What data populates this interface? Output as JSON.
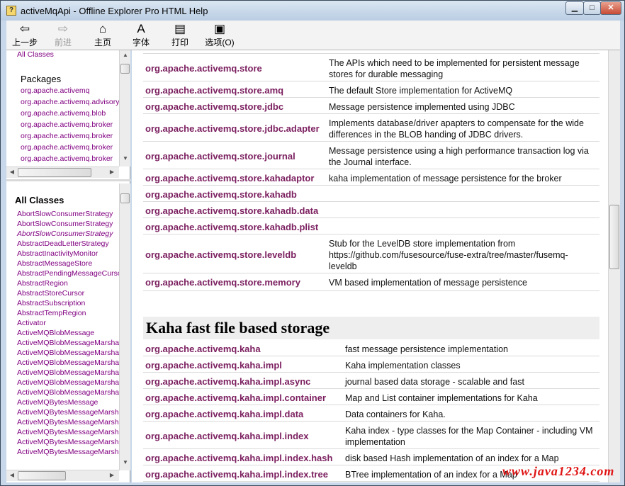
{
  "window": {
    "title": "activeMqApi - Offline Explorer Pro HTML Help",
    "app_icon": "?"
  },
  "toolbar": {
    "back": "上一步",
    "forward": "前进",
    "home": "主页",
    "font": "字体",
    "print": "打印",
    "options": "选项(O)"
  },
  "left_top": {
    "all_classes_link": "All Classes",
    "packages_heading": "Packages",
    "items": [
      "org.apache.activemq",
      "org.apache.activemq.advisory",
      "org.apache.activemq.blob",
      "org.apache.activemq.broker",
      "org.apache.activemq.broker",
      "org.apache.activemq.broker",
      "org.apache.activemq.broker"
    ]
  },
  "left_bottom": {
    "heading": "All Classes",
    "items": [
      "AbortSlowConsumerStrategy",
      "AbortSlowConsumerStrategy",
      "AbortSlowConsumerStrategy",
      "AbstractDeadLetterStrategy",
      "AbstractInactivityMonitor",
      "AbstractMessageStore",
      "AbstractPendingMessageCursor",
      "AbstractRegion",
      "AbstractStoreCursor",
      "AbstractSubscription",
      "AbstractTempRegion",
      "Activator",
      "ActiveMQBlobMessage",
      "ActiveMQBlobMessageMarshaller",
      "ActiveMQBlobMessageMarshaller",
      "ActiveMQBlobMessageMarshaller",
      "ActiveMQBlobMessageMarshaller",
      "ActiveMQBlobMessageMarshaller",
      "ActiveMQBlobMessageMarshaller",
      "ActiveMQBytesMessage",
      "ActiveMQBytesMessageMarshaller",
      "ActiveMQBytesMessageMarshaller",
      "ActiveMQBytesMessageMarshaller",
      "ActiveMQBytesMessageMarshaller",
      "ActiveMQBytesMessageMarshaller"
    ]
  },
  "store_rows": [
    {
      "pkg": "org.apache.activemq.store",
      "desc": "The APIs which need to be implemented for persistent message stores for durable messaging"
    },
    {
      "pkg": "org.apache.activemq.store.amq",
      "desc": "The default Store implementation for ActiveMQ"
    },
    {
      "pkg": "org.apache.activemq.store.jdbc",
      "desc": "Message persistence implemented using JDBC"
    },
    {
      "pkg": "org.apache.activemq.store.jdbc.adapter",
      "desc": "Implements database/driver apapters to compensate for the wide differences in the BLOB handing of JDBC drivers."
    },
    {
      "pkg": "org.apache.activemq.store.journal",
      "desc": "Message persistence using a high performance transaction log via the Journal interface."
    },
    {
      "pkg": "org.apache.activemq.store.kahadaptor",
      "desc": "kaha implementation of message persistence for the broker"
    },
    {
      "pkg": "org.apache.activemq.store.kahadb",
      "desc": ""
    },
    {
      "pkg": "org.apache.activemq.store.kahadb.data",
      "desc": ""
    },
    {
      "pkg": "org.apache.activemq.store.kahadb.plist",
      "desc": ""
    },
    {
      "pkg": "org.apache.activemq.store.leveldb",
      "desc": "Stub for the LevelDB store implementation from https://github.com/fusesource/fuse-extra/tree/master/fusemq-leveldb"
    },
    {
      "pkg": "org.apache.activemq.store.memory",
      "desc": "VM based implementation of message persistence"
    }
  ],
  "kaha_section": {
    "heading": "Kaha fast file based storage",
    "rows": [
      {
        "pkg": "org.apache.activemq.kaha",
        "desc": "fast message persistence implementation"
      },
      {
        "pkg": "org.apache.activemq.kaha.impl",
        "desc": "Kaha implementation classes"
      },
      {
        "pkg": "org.apache.activemq.kaha.impl.async",
        "desc": "journal based data storage - scalable and fast"
      },
      {
        "pkg": "org.apache.activemq.kaha.impl.container",
        "desc": "Map and List container implementations for Kaha"
      },
      {
        "pkg": "org.apache.activemq.kaha.impl.data",
        "desc": "Data containers for Kaha."
      },
      {
        "pkg": "org.apache.activemq.kaha.impl.index",
        "desc": "Kaha index - type classes for the Map Container - including VM implementation"
      },
      {
        "pkg": "org.apache.activemq.kaha.impl.index.hash",
        "desc": "disk based Hash implementation of an index for a Map"
      },
      {
        "pkg": "org.apache.activemq.kaha.impl.index.tree",
        "desc": "BTree implementation of an index for a Map"
      }
    ]
  },
  "watermark": "www.java1234.com"
}
